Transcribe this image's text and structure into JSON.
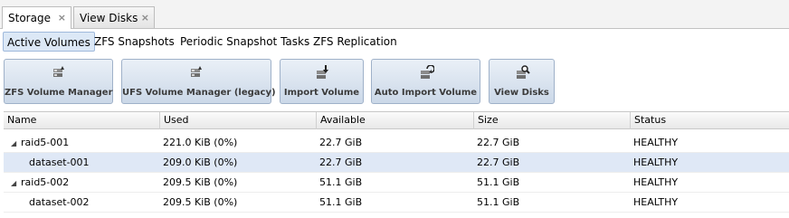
{
  "tabs": [
    {
      "label": "Storage",
      "close": "×",
      "active": true
    },
    {
      "label": "View Disks",
      "close": "×",
      "active": false
    }
  ],
  "subtabs": [
    {
      "label": "Active Volumes",
      "active": true
    },
    {
      "label": "ZFS Snapshots"
    },
    {
      "label": "Periodic Snapshot Tasks"
    },
    {
      "label": "ZFS Replication"
    }
  ],
  "toolbar": [
    {
      "label": "ZFS Volume Manager",
      "icon": "volume-manager-icon"
    },
    {
      "label": "UFS Volume Manager (legacy)",
      "icon": "volume-manager-icon"
    },
    {
      "label": "Import Volume",
      "icon": "import-icon"
    },
    {
      "label": "Auto Import Volume",
      "icon": "auto-import-icon"
    },
    {
      "label": "View Disks",
      "icon": "view-disks-icon"
    }
  ],
  "grid": {
    "columns": [
      "Name",
      "Used",
      "Available",
      "Size",
      "Status"
    ],
    "rows": [
      {
        "name": "raid5-001",
        "expander": "◢",
        "used": "221.0 KiB (0%)",
        "available": "22.7 GiB",
        "size": "22.7 GiB",
        "status": "HEALTHY"
      },
      {
        "name": "dataset-001",
        "expander": "",
        "used": "209.0 KiB (0%)",
        "available": "22.7 GiB",
        "size": "22.7 GiB",
        "status": "HEALTHY",
        "selected": true
      },
      {
        "name": "raid5-002",
        "expander": "◢",
        "used": "209.5 KiB (0%)",
        "available": "51.1 GiB",
        "size": "51.1 GiB",
        "status": "HEALTHY"
      },
      {
        "name": "dataset-002",
        "expander": "",
        "used": "209.5 KiB (0%)",
        "available": "51.1 GiB",
        "size": "51.1 GiB",
        "status": "HEALTHY"
      }
    ]
  },
  "colors": {
    "selected_row": "#dfe8f6",
    "toolbar_button_border": "#9fb1c9",
    "active_subtab": "#dce8f6"
  }
}
